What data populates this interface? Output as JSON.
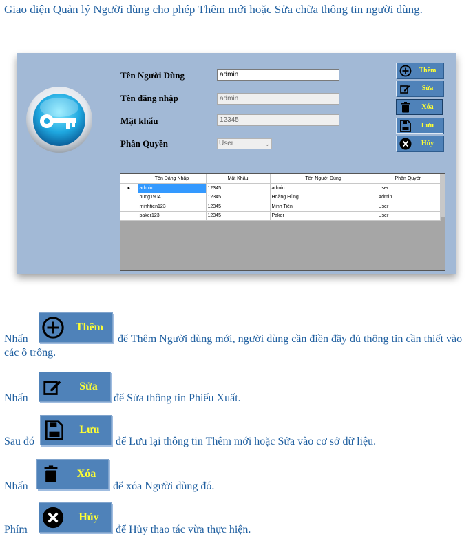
{
  "intro": "Giao diện Quản lý Người dùng cho phép Thêm mới hoặc Sửa chữa thông tin người dùng.",
  "form": {
    "name_label": "Tên Người Dùng",
    "name_value": "admin",
    "login_label": "Tên đăng nhập",
    "login_value": "admin",
    "password_label": "Mật khẩu",
    "password_value": "12345",
    "role_label": "Phân Quyền",
    "role_value": "User"
  },
  "buttons": {
    "add": "Thêm",
    "edit": "Sửa",
    "delete": "Xóa",
    "save": "Lưu",
    "cancel": "Hủy"
  },
  "table": {
    "columns": [
      "Tên Đăng Nhập",
      "Mật Khẩu",
      "Tên Người Dùng",
      "Phân Quyền"
    ],
    "rows": [
      [
        "admin",
        "12345",
        "admin",
        "User"
      ],
      [
        "hung1904",
        "12345",
        "Hoàng Hùng",
        "Admin"
      ],
      [
        "minhtien123",
        "12345",
        "Minh Tiến",
        "User"
      ],
      [
        "paker123",
        "12345",
        "Paker",
        "User"
      ]
    ]
  },
  "instructions": {
    "add_prefix": "Nhấn",
    "add_text": "để Thêm Người dùng mới, người dùng cần điền đầy đủ thông tin cần thiết vào các ô trống.",
    "edit_prefix": "Nhấn",
    "edit_text": "để Sửa thông tin Phiếu Xuất.",
    "save_prefix": "Sau đó",
    "save_text": "để Lưu lại thông tin Thêm mới hoặc Sửa vào cơ sở dữ liệu.",
    "delete_prefix": "Nhấn",
    "delete_text": "để xóa Người dùng đó.",
    "cancel_prefix": "Phím",
    "cancel_text": "để Hủy thao tác vừa thực hiện."
  },
  "colors": {
    "text": "#1f5fa0",
    "window_bg": "#a2b9d6",
    "button_bg": "#4f82b9",
    "button_label": "#ffff33",
    "selected_row": "#3399ff"
  }
}
